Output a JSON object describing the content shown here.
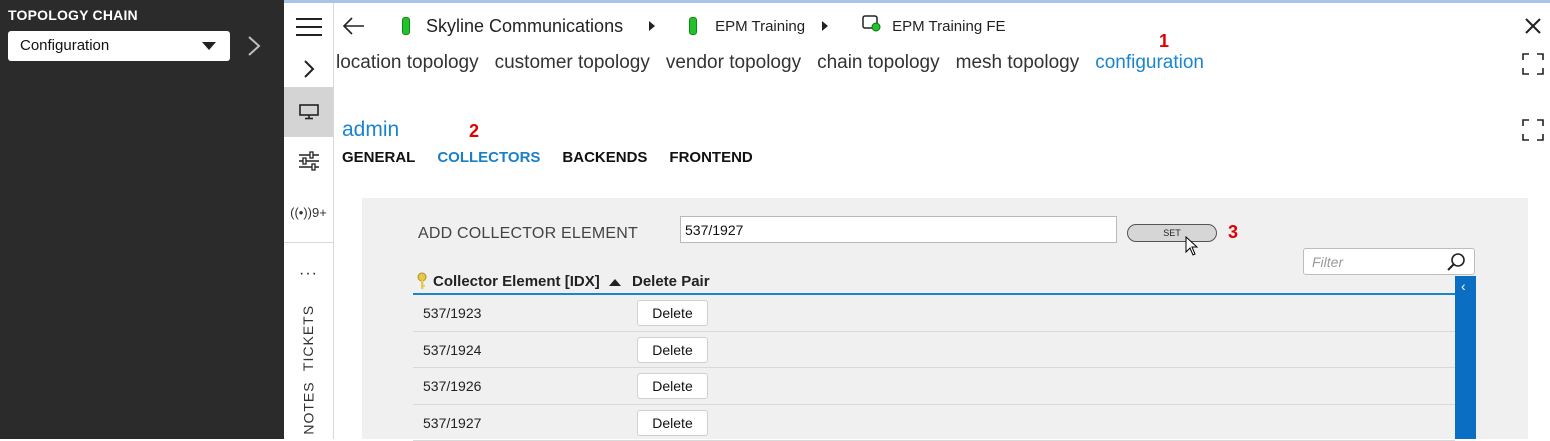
{
  "left_panel": {
    "title": "TOPOLOGY CHAIN",
    "selected": "Configuration"
  },
  "header": {
    "crumbs": [
      {
        "label": "Skyline Communications",
        "status_color": "#22c32a"
      },
      {
        "label": "EPM Training",
        "status_color": "#22c32a"
      },
      {
        "label": "EPM Training FE"
      }
    ]
  },
  "rail": {
    "notifications": "((•))9+",
    "more": "···",
    "tickets": "TICKETS",
    "notes": "NOTES"
  },
  "topology_tabs": [
    {
      "label": "location topology",
      "active": false
    },
    {
      "label": "customer topology",
      "active": false
    },
    {
      "label": "vendor topology",
      "active": false
    },
    {
      "label": "chain topology",
      "active": false
    },
    {
      "label": "mesh topology",
      "active": false
    },
    {
      "label": "configuration",
      "active": true
    }
  ],
  "markers": [
    "1",
    "2",
    "3"
  ],
  "admin": {
    "title": "admin",
    "tabs": [
      {
        "label": "GENERAL",
        "active": false
      },
      {
        "label": "COLLECTORS",
        "active": true
      },
      {
        "label": "BACKENDS",
        "active": false
      },
      {
        "label": "FRONTEND",
        "active": false
      }
    ]
  },
  "collector_form": {
    "label": "ADD COLLECTOR ELEMENT",
    "value": "537/1927",
    "set_label": "SET",
    "filter_placeholder": "Filter"
  },
  "table": {
    "columns": [
      "Collector Element [IDX]",
      "Delete Pair"
    ],
    "delete_label": "Delete",
    "rows": [
      "537/1923",
      "537/1924",
      "537/1926",
      "537/1927"
    ]
  },
  "colors": {
    "accent": "#1a85cf",
    "marker": "#e00000",
    "sidebar": "#2b2b2b"
  }
}
